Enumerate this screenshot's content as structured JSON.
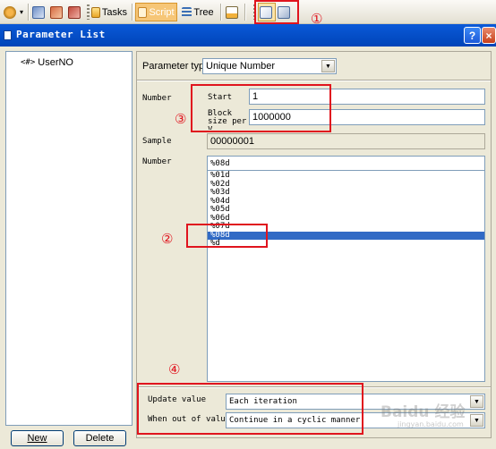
{
  "toolbar": {
    "tasks_label": "Tasks",
    "script_label": "Script",
    "tree_label": "Tree"
  },
  "window": {
    "title": "Parameter List",
    "help_symbol": "?",
    "close_symbol": "×"
  },
  "left_panel": {
    "tree_prefix": "<#>",
    "tree_item": "UserNO",
    "new_button": "New",
    "delete_button": "Delete"
  },
  "parameter_type": {
    "label": "Parameter type:",
    "value": "Unique Number"
  },
  "number_section": {
    "label": "Number",
    "start_label": "Start",
    "start_value": "1",
    "block_label_line1": "Block",
    "block_label_line2": "size per",
    "block_label_line3": "V...",
    "block_value": "1000000"
  },
  "sample": {
    "label": "Sample",
    "value": "00000001"
  },
  "number_format": {
    "label": "Number",
    "current": "%08d",
    "options": [
      "%01d",
      "%02d",
      "%03d",
      "%04d",
      "%05d",
      "%06d",
      "%07d",
      "%08d",
      "%d"
    ],
    "selected_index": 7
  },
  "update_value": {
    "label": "Update value",
    "value": "Each iteration"
  },
  "out_of_values": {
    "label": "When out of values",
    "value": "Continue in a cyclic manner"
  },
  "annotations": {
    "m1": "①",
    "m2": "②",
    "m3": "③",
    "m4": "④"
  },
  "watermark": {
    "text": "Baidu 经验",
    "sub": "jingyan.baidu.com"
  },
  "colors": {
    "title_bar": "#0a59d8",
    "selection": "#316ac5",
    "annotation_red": "#e0141e",
    "panel_bg": "#ece9d8"
  }
}
